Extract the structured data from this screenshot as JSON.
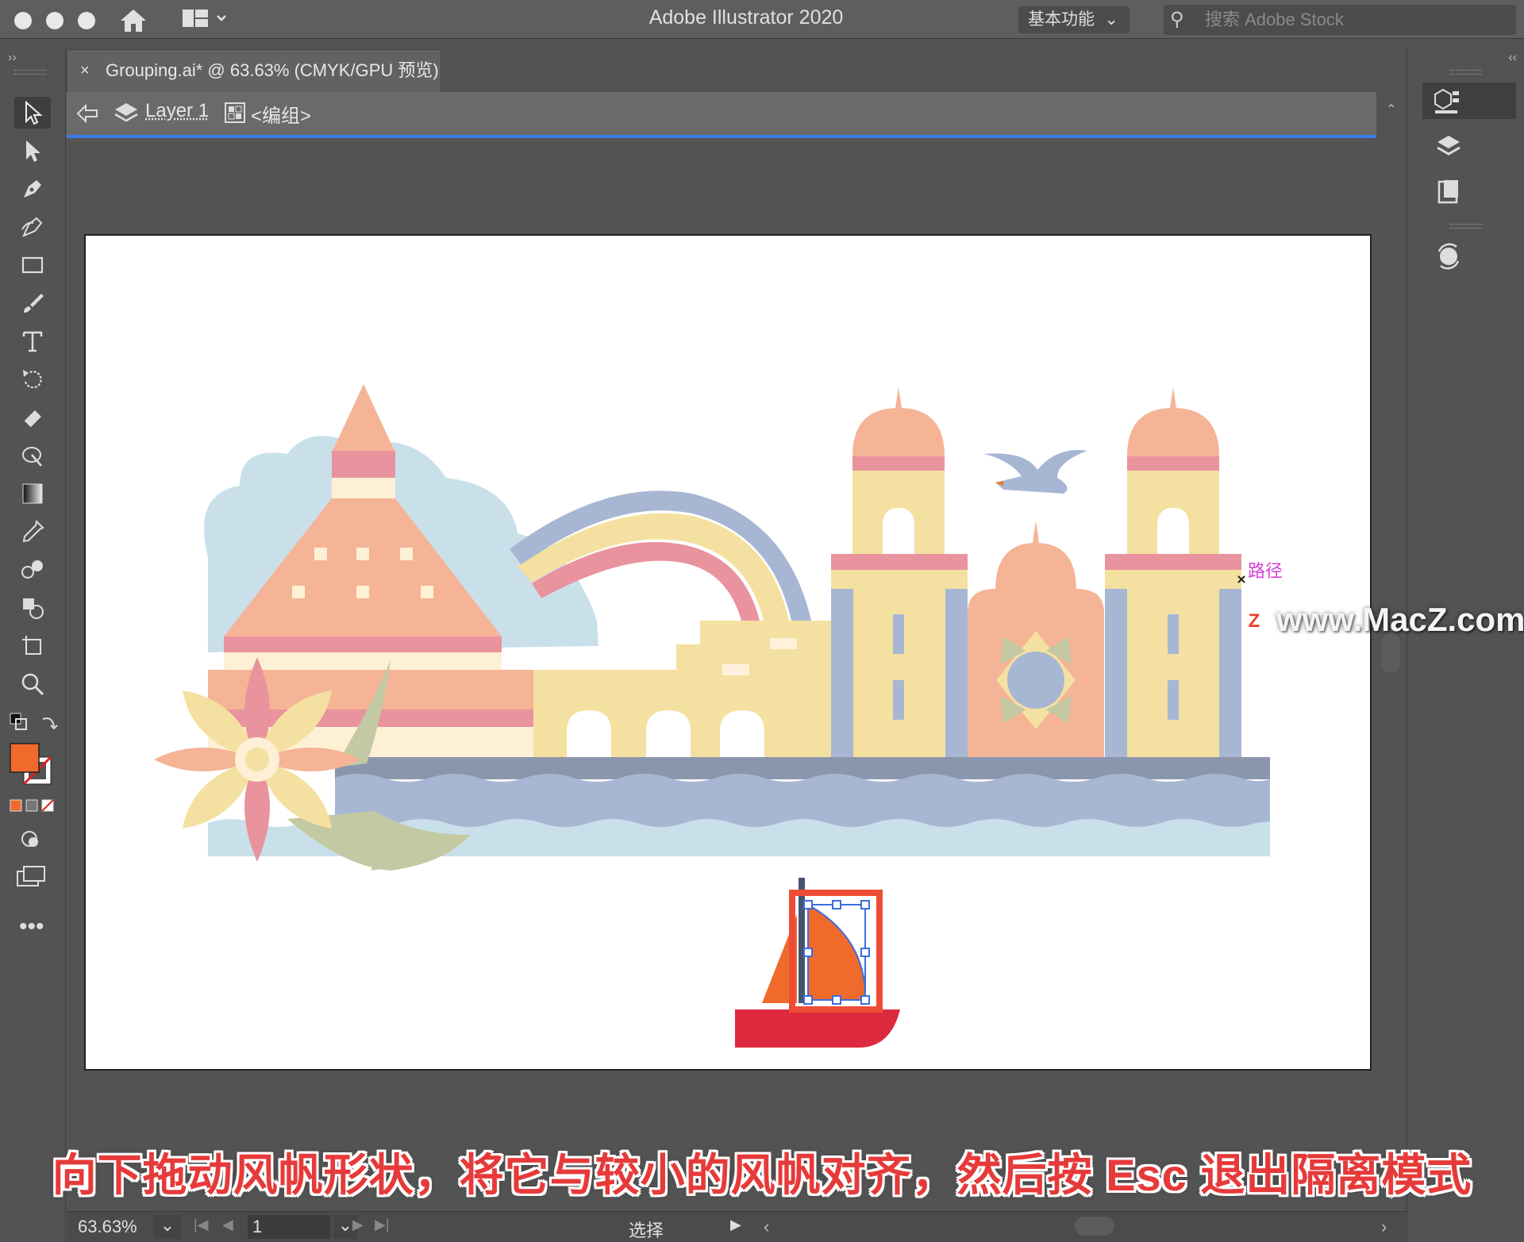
{
  "window": {
    "app_title": "Adobe Illustrator 2020",
    "workspace": "基本功能",
    "stock_search_placeholder": "搜索 Adobe Stock"
  },
  "document_tab": {
    "close": "×",
    "name": "Grouping.ai* @ 63.63% (CMYK/GPU 预览)"
  },
  "isolation_bar": {
    "layer": "Layer 1",
    "group": "<编组>"
  },
  "canvas": {
    "hover_label": "路径",
    "watermark": "www.MacZ.com",
    "watermark_badge": "Z"
  },
  "status_bar": {
    "zoom": "63.63%",
    "page": "1",
    "tool": "选择"
  },
  "subtitle": "向下拖动风帆形状，将它与较小的风帆对齐，然后按 Esc 退出隔离模式",
  "colors": {
    "fill": "#f06a2c",
    "accent_blue": "#3b7be8",
    "selection": "#3b6ee0"
  },
  "icons": {
    "toolbar": [
      "selection-tool-icon",
      "direct-selection-tool-icon",
      "pen-tool-icon",
      "curvature-tool-icon",
      "rectangle-tool-icon",
      "paintbrush-tool-icon",
      "type-tool-icon",
      "rotate-tool-icon",
      "eraser-tool-icon",
      "width-tool-icon",
      "gradient-tool-icon",
      "eyedropper-tool-icon",
      "blend-tool-icon",
      "shape-builder-tool-icon",
      "artboard-tool-icon",
      "zoom-tool-icon"
    ]
  }
}
